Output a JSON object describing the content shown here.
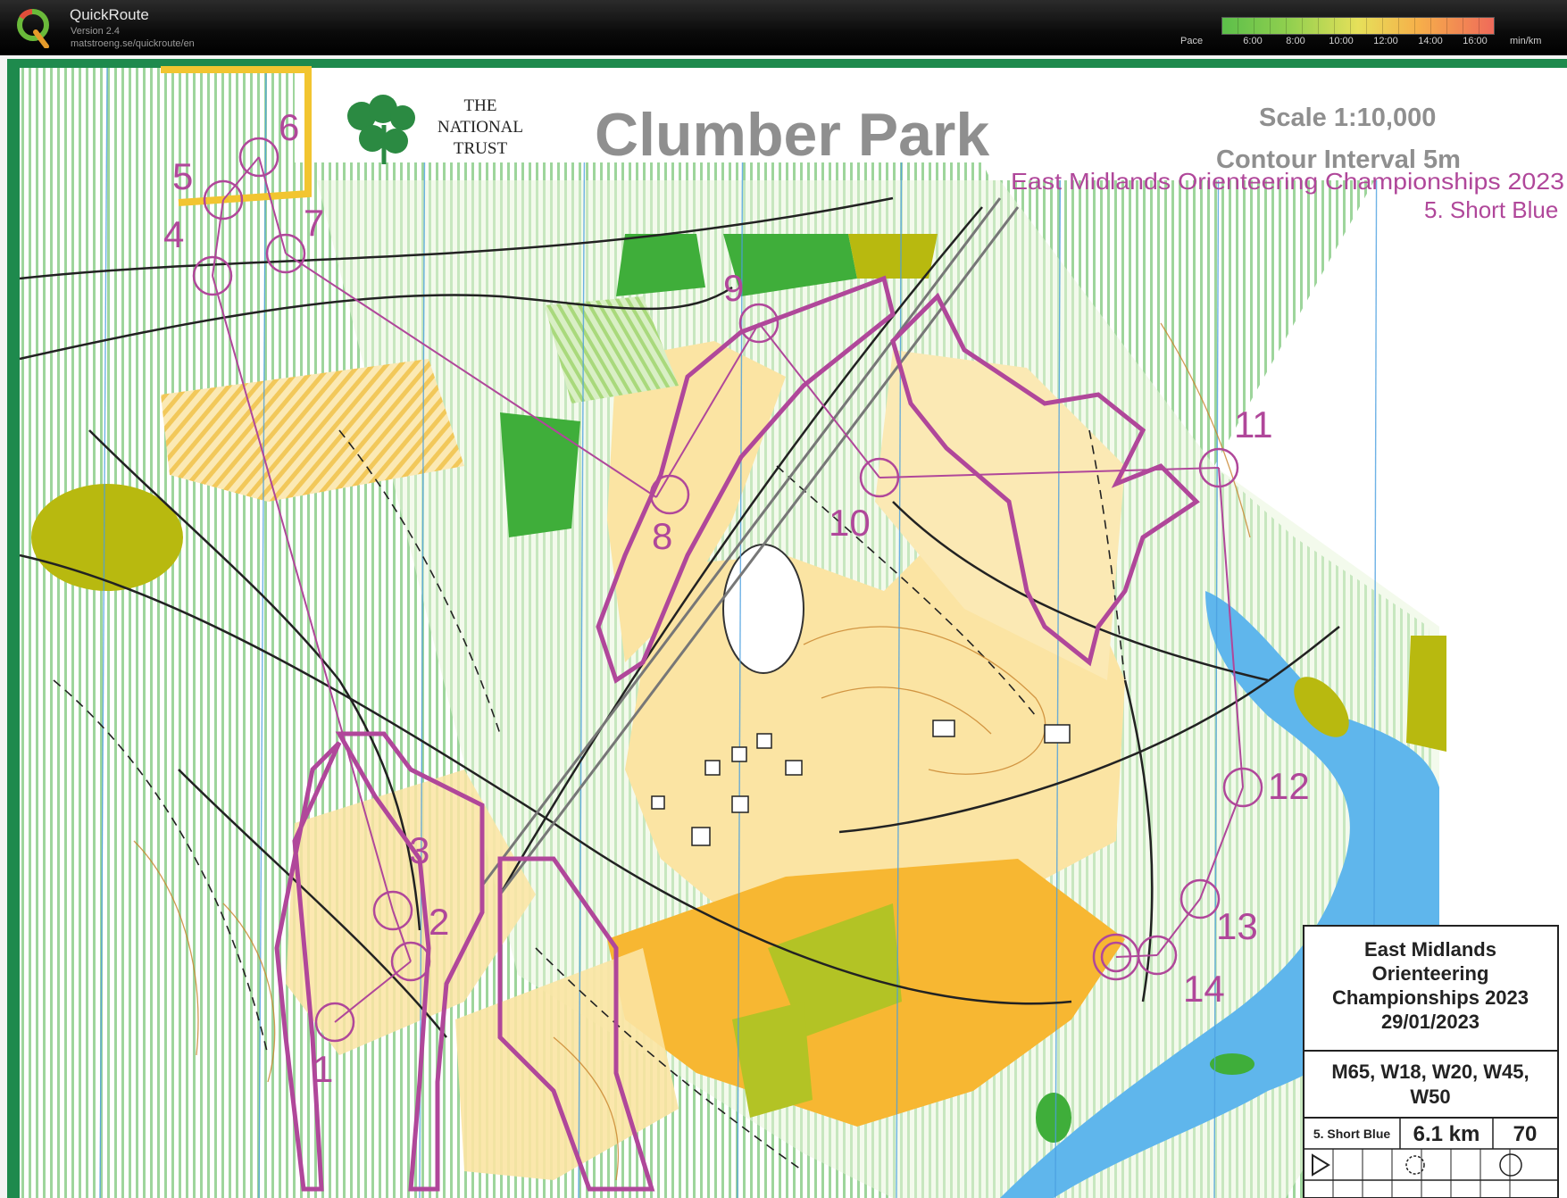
{
  "app": {
    "title": "QuickRoute",
    "version": "Version 2.4",
    "url": "matstroeng.se/quickroute/en"
  },
  "pace_scale": {
    "label": "Pace",
    "ticks": [
      "6:00",
      "8:00",
      "10:00",
      "12:00",
      "14:00",
      "16:00"
    ],
    "unit": "min/km"
  },
  "map": {
    "title": "Clumber Park",
    "org_logo_text": [
      "THE",
      "NATIONAL",
      "TRUST"
    ],
    "scale": "Scale 1:10,000",
    "contour": "Contour Interval 5m",
    "event_line1": "East Midlands Orienteering Championships 2023",
    "event_line2": "5. Short Blue",
    "controls": [
      "1",
      "2",
      "3",
      "4",
      "5",
      "6",
      "7",
      "8",
      "9",
      "10",
      "11",
      "12",
      "13",
      "14"
    ],
    "colors": {
      "course": "#b0479a",
      "green_dark": "#3fae3a",
      "green_light": "#cfe9c2",
      "yellow_open": "#f6d37a",
      "yellow_rough": "#fbe9b4",
      "water": "#5fb6ec",
      "olive": "#b8b90f"
    }
  },
  "info_box": {
    "event": [
      "East Midlands",
      "Orienteering",
      "Championships 2023",
      "29/01/2023"
    ],
    "classes": [
      "M65, W18, W20, W45,",
      "W50"
    ],
    "course_name": "5. Short Blue",
    "length": "6.1 km",
    "climb": "70"
  }
}
